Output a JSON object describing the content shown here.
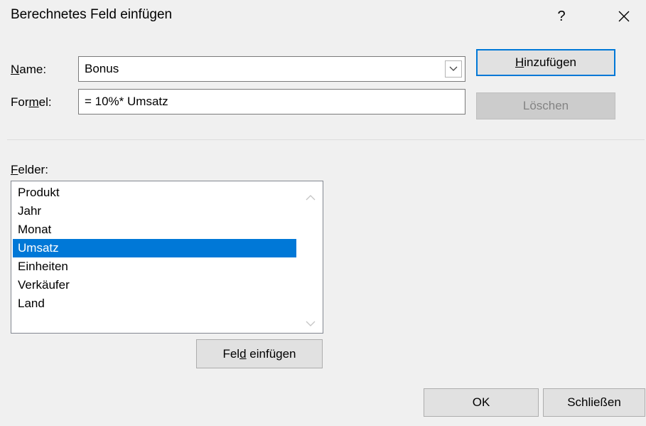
{
  "dialog": {
    "title": "Berechnetes Feld einfügen",
    "help_glyph": "?",
    "close_glyph": "✕"
  },
  "name_row": {
    "label_prefix": "N",
    "label_rest": "ame:",
    "value": "Bonus"
  },
  "formula_row": {
    "label_prefix": "For",
    "label_accel": "m",
    "label_rest": "el:",
    "value": "= 10%* Umsatz"
  },
  "buttons": {
    "add_accel": "H",
    "add_rest": "inzufügen",
    "delete_label": "Löschen",
    "insert_field_prefix": "Fel",
    "insert_field_accel": "d",
    "insert_field_rest": " einfügen",
    "ok_label": "OK",
    "close_label": "Schließen"
  },
  "fields": {
    "label_accel": "F",
    "label_rest": "elder:",
    "items": [
      "Produkt",
      "Jahr",
      "Monat",
      "Umsatz",
      "Einheiten",
      "Verkäufer",
      "Land"
    ],
    "selected": "Umsatz"
  },
  "colors": {
    "accent": "#0078d7",
    "background": "#f0f0f0"
  }
}
